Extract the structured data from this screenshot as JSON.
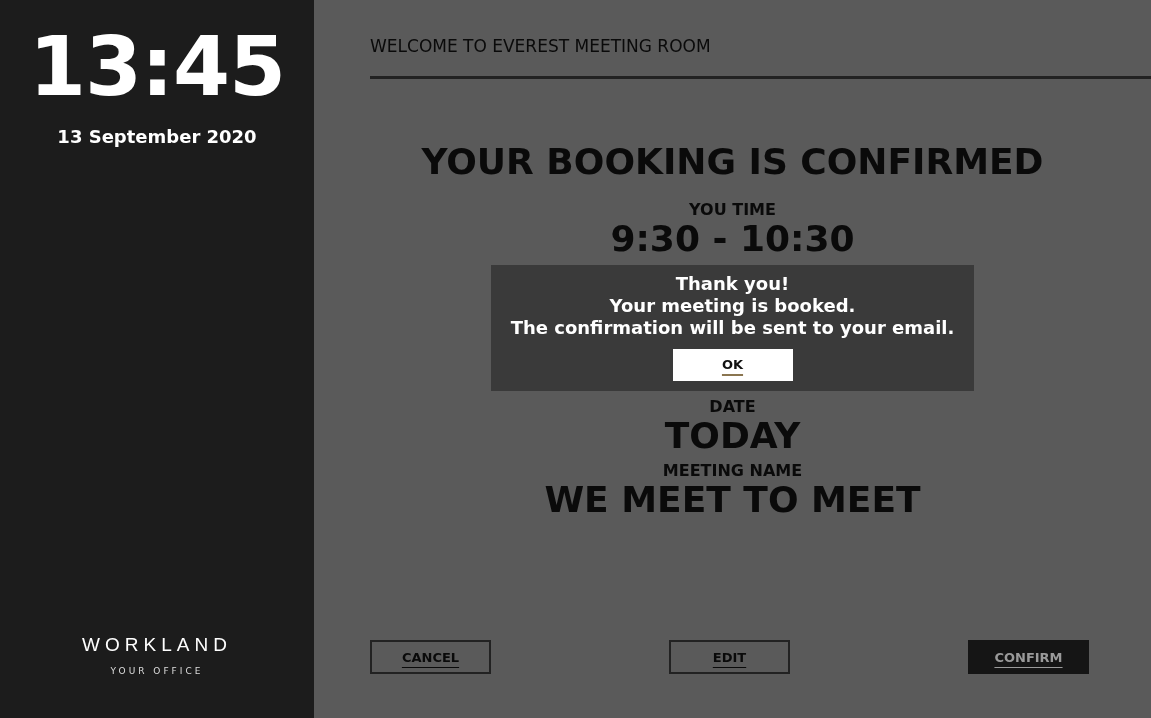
{
  "sidebar": {
    "time": "13:45",
    "date": "13 September 2020",
    "logo": {
      "name": "WORKLAND",
      "tagline": "YOUR OFFICE"
    }
  },
  "header": {
    "title": "WELCOME TO EVEREST MEETING ROOM"
  },
  "booking": {
    "heading": "YOUR BOOKING IS CONFIRMED",
    "fields": [
      {
        "label": "YOU TIME",
        "value": "9:30 - 10:30"
      },
      {
        "label": "DATE",
        "value": "TODAY"
      },
      {
        "label": "MEETING NAME",
        "value": "WE MEET TO MEET"
      }
    ]
  },
  "actions": [
    {
      "label": "CANCEL",
      "kind": "outline"
    },
    {
      "label": "EDIT",
      "kind": "outline"
    },
    {
      "label": "CONFIRM",
      "kind": "filled"
    }
  ],
  "dialog": {
    "lines": [
      "Thank you!",
      "Your meeting is booked.",
      "The confirmation will be sent to your email."
    ],
    "button": "OK"
  }
}
